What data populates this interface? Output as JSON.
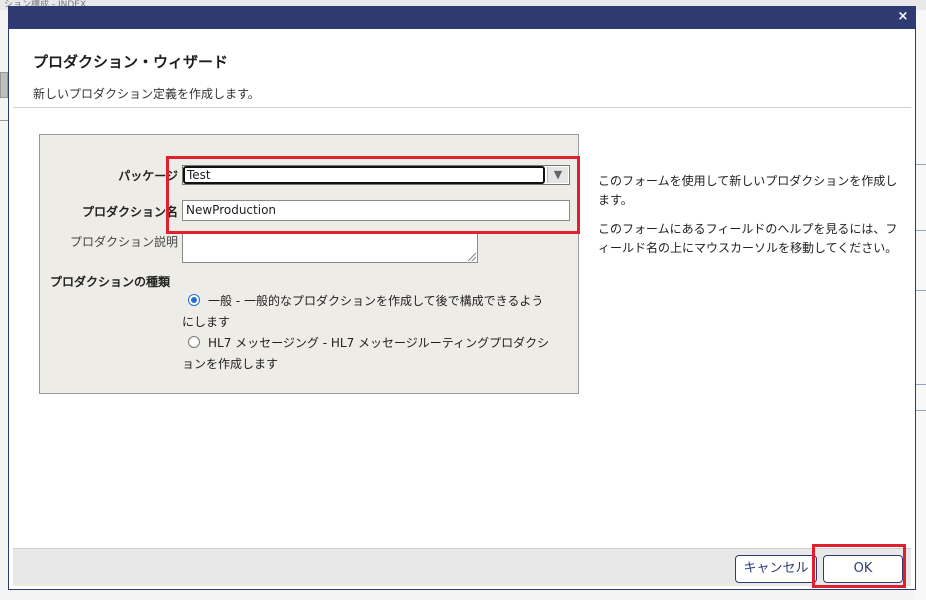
{
  "background": {
    "topbar_text": "ション構成 - INDEX..."
  },
  "dialog": {
    "close_label": "×"
  },
  "wizard": {
    "title": "プロダクション・ウィザード",
    "subtitle": "新しいプロダクション定義を作成します。"
  },
  "form": {
    "package_label": "パッケージ",
    "package_value": "Test",
    "production_name_label": "プロダクション名",
    "production_name_value": "NewProduction",
    "description_label": "プロダクション説明",
    "description_value": "",
    "type_label": "プロダクションの種類",
    "option_general": "一般 - 一般的なプロダクションを作成して後で構成できるようにします",
    "option_hl7": "HL7 メッセージング - HL7 メッセージルーティングプロダクションを作成します",
    "selected_option": "general"
  },
  "help": {
    "line1": "このフォームを使用して新しいプロダクションを作成します。",
    "line2": "このフォームにあるフィールドのヘルプを見るには、フィールド名の上にマウスカーソルを移動してください。"
  },
  "footer": {
    "cancel_label": "キャンセル",
    "ok_label": "OK"
  },
  "colors": {
    "titlebar": "#2f3a73",
    "highlight": "#e0202c",
    "radio_selected": "#2b6cd0"
  }
}
